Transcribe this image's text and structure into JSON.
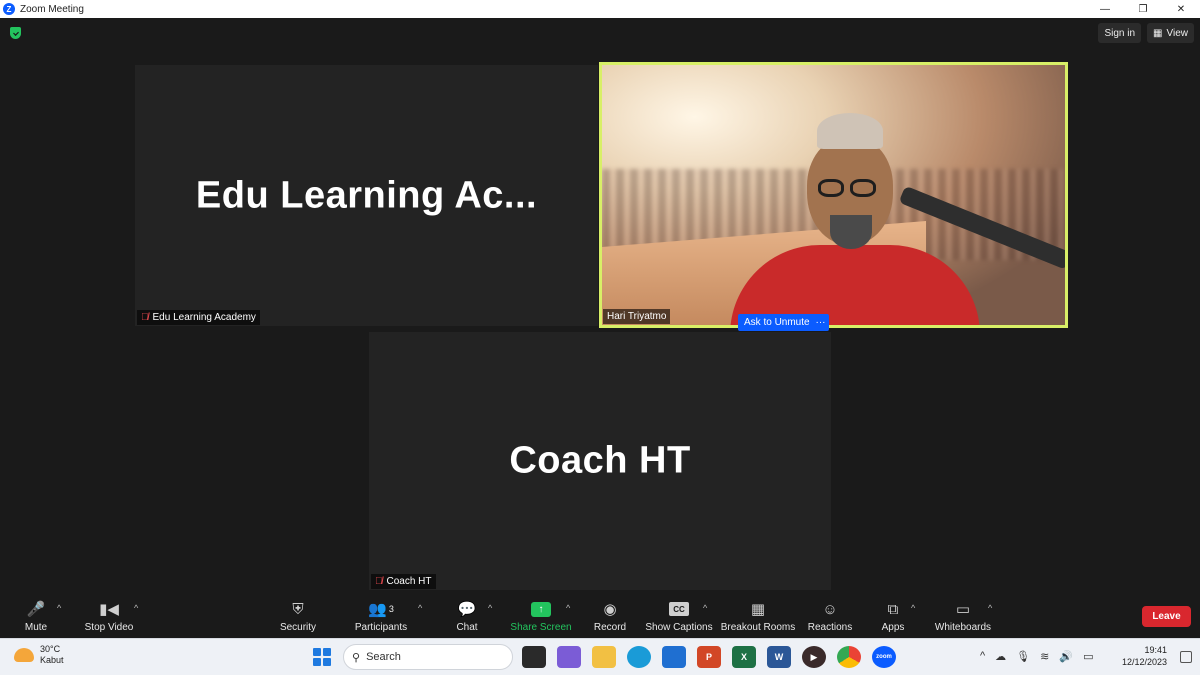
{
  "window": {
    "title": "Zoom Meeting"
  },
  "header": {
    "signin_label": "Sign in",
    "view_label": "View"
  },
  "tiles": [
    {
      "display_name": "Edu Learning Ac...",
      "name_label": "Edu Learning Academy"
    },
    {
      "name_label": "Hari Triyatmo"
    },
    {
      "display_name": "Coach HT",
      "name_label": "Coach HT"
    }
  ],
  "actions": {
    "ask_unmute": "Ask to Unmute",
    "more": "···"
  },
  "toolbar": {
    "mute": "Mute",
    "stop_video": "Stop Video",
    "security": "Security",
    "participants": "Participants",
    "participants_count": "3",
    "chat": "Chat",
    "share_screen": "Share Screen",
    "record": "Record",
    "show_captions": "Show Captions",
    "cc": "CC",
    "breakout_rooms": "Breakout Rooms",
    "reactions": "Reactions",
    "apps": "Apps",
    "whiteboards": "Whiteboards",
    "leave": "Leave"
  },
  "taskbar": {
    "weather_temp": "30°C",
    "weather_desc": "Kabut",
    "search_placeholder": "Search",
    "time": "19:41",
    "date": "12/12/2023"
  },
  "colors": {
    "accent": "#0b5cff",
    "share_green": "#23c45e",
    "leave_red": "#d9272e",
    "active_speaker": "#d8ef67"
  }
}
